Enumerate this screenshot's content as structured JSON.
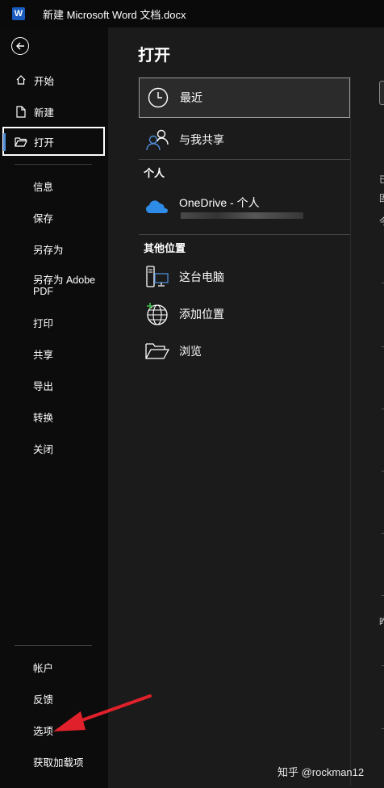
{
  "titlebar": {
    "logo": "W",
    "title": "新建 Microsoft Word 文档.docx"
  },
  "sidebar": {
    "top_items": [
      {
        "label": "开始",
        "icon": "home-icon"
      },
      {
        "label": "新建",
        "icon": "new-document-icon"
      },
      {
        "label": "打开",
        "icon": "open-folder-icon"
      }
    ],
    "mid_items": [
      "信息",
      "保存",
      "另存为",
      "另存为 Adobe PDF",
      "打印",
      "共享",
      "导出",
      "转换",
      "关闭"
    ],
    "bottom_items": [
      "帐户",
      "反馈",
      "选项",
      "获取加载项"
    ]
  },
  "main": {
    "heading": "打开",
    "recent": "最近",
    "shared": "与我共享",
    "personal_label": "个人",
    "onedrive": "OneDrive - 个人",
    "other_label": "其他位置",
    "this_pc": "这台电脑",
    "add_place": "添加位置",
    "browse": "浏览"
  },
  "right_panel": {
    "frag1": "已",
    "frag2": "固",
    "frag3": "今",
    "frag4": "昨"
  },
  "watermark": "知乎 @rockman12",
  "colors": {
    "accent": "#4f8bd6",
    "onedrive": "#2f8be8",
    "arrow": "#e0202a",
    "word_blue": "#185abd"
  }
}
